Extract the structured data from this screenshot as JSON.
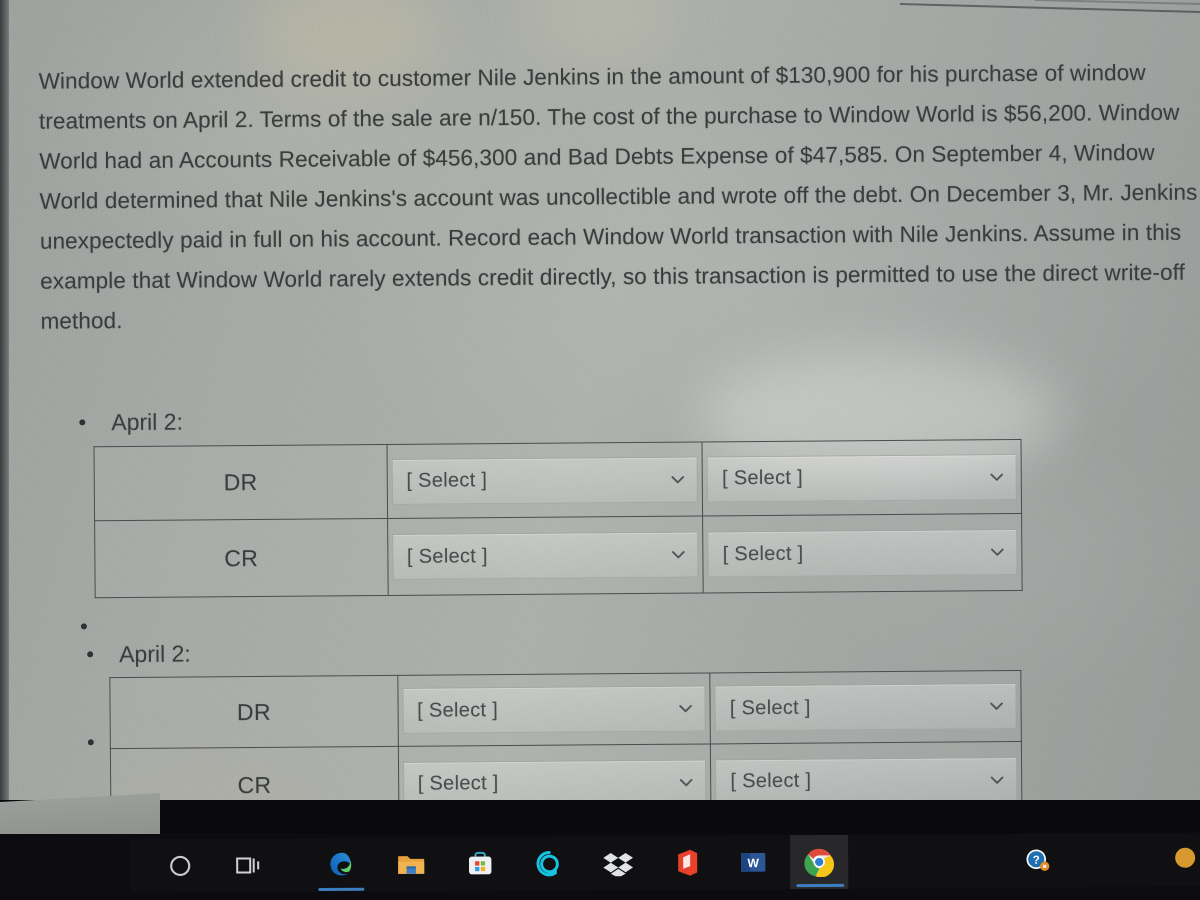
{
  "question": {
    "text": "Window World extended credit to customer Nile Jenkins in the amount of $130,900 for his purchase of window treatments on April 2. Terms of the sale are n/150. The cost of the purchase to Window World is $56,200. Window World had an Accounts Receivable of $456,300 and Bad Debts Expense of $47,585. On September 4, Window World determined that Nile Jenkins's account was uncollectible and wrote off the debt. On December 3, Mr. Jenkins unexpectedly paid in full on his account. Record each Window World transaction with Nile Jenkins. Assume in this example that Window World rarely extends credit directly, so this transaction is permitted to use the direct write-off method.",
    "amounts": {
      "credit_extended": "$130,900",
      "cost_of_purchase": "$56,200",
      "accounts_receivable": "$456,300",
      "bad_debts_expense": "$47,585"
    },
    "terms": "n/150",
    "dates": {
      "sale": "April 2",
      "writeoff": "September 4",
      "recovery": "December 3"
    },
    "customer": "Nile Jenkins",
    "company": "Window World",
    "method": "direct write-off method"
  },
  "entries": [
    {
      "label": "April 2:",
      "rows": [
        {
          "side": "DR",
          "account_select": "[ Select ]",
          "amount_select": "[ Select ]"
        },
        {
          "side": "CR",
          "account_select": "[ Select ]",
          "amount_select": "[ Select ]"
        }
      ]
    },
    {
      "label": "April 2:",
      "rows": [
        {
          "side": "DR",
          "account_select": "[ Select ]",
          "amount_select": "[ Select ]"
        },
        {
          "side": "CR",
          "account_select": "[ Select ]",
          "amount_select": "[ Select ]"
        }
      ]
    }
  ],
  "taskbar": {
    "items": [
      {
        "name": "cortana-icon",
        "label": "Cortana"
      },
      {
        "name": "task-view-icon",
        "label": "Task View"
      },
      {
        "name": "edge-icon",
        "label": "Microsoft Edge"
      },
      {
        "name": "file-explorer-icon",
        "label": "File Explorer"
      },
      {
        "name": "microsoft-store-icon",
        "label": "Microsoft Store"
      },
      {
        "name": "alexa-icon",
        "label": "Alexa"
      },
      {
        "name": "dropbox-icon",
        "label": "Dropbox"
      },
      {
        "name": "office-icon",
        "label": "Microsoft Office"
      },
      {
        "name": "word-icon",
        "label": "Microsoft Word"
      },
      {
        "name": "chrome-icon",
        "label": "Google Chrome"
      },
      {
        "name": "get-help-icon",
        "label": "Get Help"
      },
      {
        "name": "notification-dot",
        "label": "Notification"
      }
    ],
    "active_item": "chrome-icon"
  },
  "colors": {
    "screen_bg": "#a7aaa6",
    "text": "#3a3c3e",
    "table_border": "#4a4c4d",
    "taskbar_bg": "#0c0c10",
    "active_underline": "#3d7ebf"
  }
}
